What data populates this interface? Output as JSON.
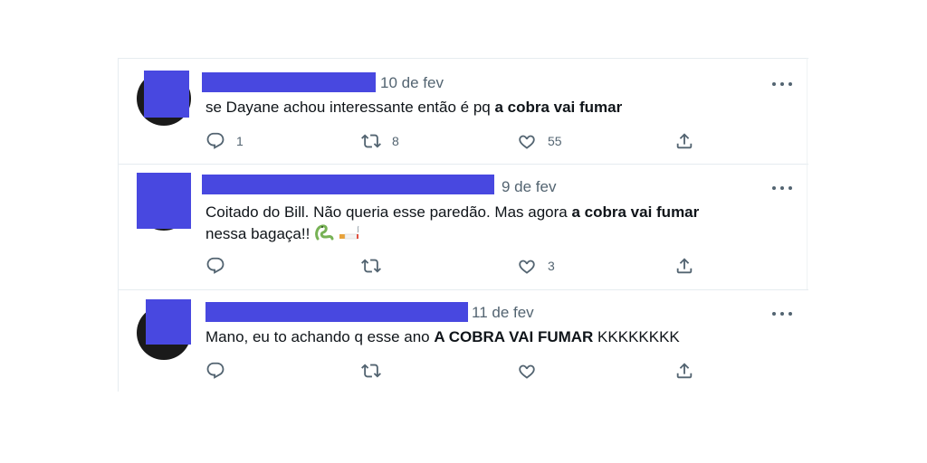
{
  "tweets": [
    {
      "date": "10 de fev",
      "text_prefix": "se Dayane achou interessante então é pq ",
      "text_bold": "a cobra vai fumar",
      "text_suffix": "",
      "text_line2": "",
      "emoji": [],
      "replies": "1",
      "retweets": "8",
      "likes": "55"
    },
    {
      "date": "9 de fev",
      "text_prefix": "Coitado do Bill. Não queria esse paredão. Mas agora ",
      "text_bold": "a cobra vai fumar",
      "text_suffix": "",
      "text_line2": "nessa bagaça!!",
      "emoji": [
        "snake",
        "cigarette"
      ],
      "replies": "",
      "retweets": "",
      "likes": "3"
    },
    {
      "date": "11 de fev",
      "text_prefix": "Mano, eu to achando q esse ano ",
      "text_bold": "A COBRA VAI FUMAR",
      "text_suffix": " KKKKKKKK",
      "text_line2": "",
      "emoji": [],
      "replies": "",
      "retweets": "",
      "likes": ""
    }
  ],
  "colors": {
    "redaction": "#4848e0",
    "secondary_text": "#536471",
    "divider": "#e6ecf0"
  },
  "icons": {
    "reply": "reply-icon",
    "retweet": "retweet-icon",
    "like": "heart-icon",
    "share": "share-icon",
    "more": "more-icon"
  }
}
